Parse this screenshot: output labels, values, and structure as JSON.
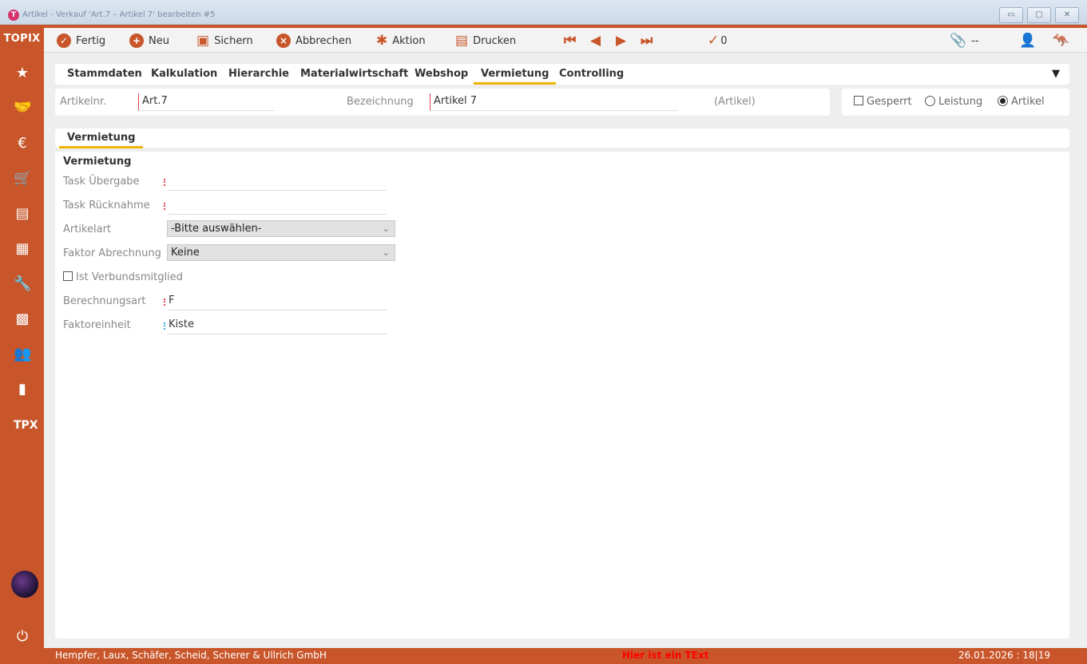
{
  "window": {
    "title": "Artikel - Verkauf 'Art.7 – Artikel 7' bearbeiten #5",
    "app_icon_letter": "T",
    "minimize_label": "▭",
    "maximize_label": "▢",
    "close_label": "✕"
  },
  "sidebar": {
    "logo": "TOPIX",
    "items": [
      "star-icon",
      "handshake-icon",
      "invoice-icon",
      "cart-icon",
      "warehouse-icon",
      "archive-icon",
      "wrench-icon",
      "calculator-icon",
      "people-icon",
      "bar-chart-icon",
      "tpx-icon"
    ],
    "power_icon": "power-icon"
  },
  "toolbar": {
    "fertig": "Fertig",
    "neu": "Neu",
    "sichern": "Sichern",
    "abbrechen": "Abbrechen",
    "aktion": "Aktion",
    "drucken": "Drucken",
    "check_count": "0",
    "attach_text": "--"
  },
  "tabs": [
    "Stammdaten",
    "Kalkulation",
    "Hierarchie",
    "Materialwirtschaft",
    "Webshop",
    "Vermietung",
    "Controlling"
  ],
  "active_tab": "Vermietung",
  "header": {
    "artikelnr_label": "Artikelnr.",
    "artikelnr_value": "Art.7",
    "bezeichnung_label": "Bezeichnung",
    "bezeichnung_value": "Artikel 7",
    "type_hint": "(Artikel)",
    "gesperrt_label": "Gesperrt",
    "leistung_label": "Leistung",
    "artikel_label": "Artikel",
    "selected_type": "Artikel"
  },
  "subtab": "Vermietung",
  "section": {
    "title": "Vermietung",
    "task_uebergabe_label": "Task Übergabe",
    "task_uebergabe_value": "",
    "task_ruecknahme_label": "Task Rücknahme",
    "task_ruecknahme_value": "",
    "artikelart_label": "Artikelart",
    "artikelart_value": "-Bitte auswählen-",
    "faktor_label": "Faktor Abrechnung",
    "faktor_value": "Keine",
    "verbund_label": "Ist Verbundsmitglied",
    "berechnungsart_label": "Berechnungsart",
    "berechnungsart_value": "F",
    "faktoreinheit_label": "Faktoreinheit",
    "faktoreinheit_value": "Kiste"
  },
  "status": {
    "company": "Hempfer, Laux, Schäfer, Scheid, Scherer & Ullrich GmbH",
    "message": "Hier ist ein TExt",
    "datetime": "26.01.2026 : 18|19"
  },
  "colors": {
    "accent": "#c8562a",
    "tab_underline": "#f0b400",
    "required_marker": "#e0464b",
    "status_message": "#ff0000"
  }
}
